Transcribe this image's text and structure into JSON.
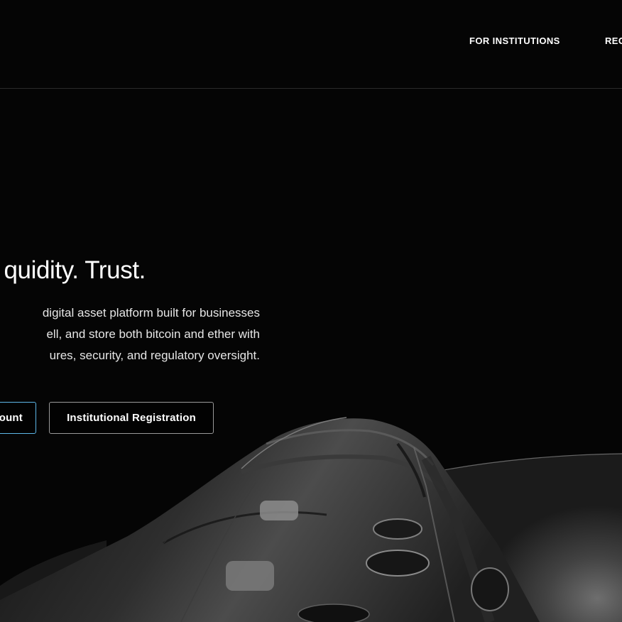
{
  "nav": {
    "items": [
      {
        "label": "FOR INSTITUTIONS"
      },
      {
        "label": "REG"
      }
    ]
  },
  "hero": {
    "headline": "quidity. Trust.",
    "description": "digital asset platform built for businesses\nell, and store both bitcoin and ether with\nures, security, and regulatory oversight.",
    "buttons": {
      "account_label": "ount",
      "institutional_label": "Institutional Registration"
    }
  },
  "colors": {
    "background": "#050505",
    "accent_border": "#5db7e8",
    "secondary_border": "#9a9a9a",
    "text": "#ffffff"
  }
}
